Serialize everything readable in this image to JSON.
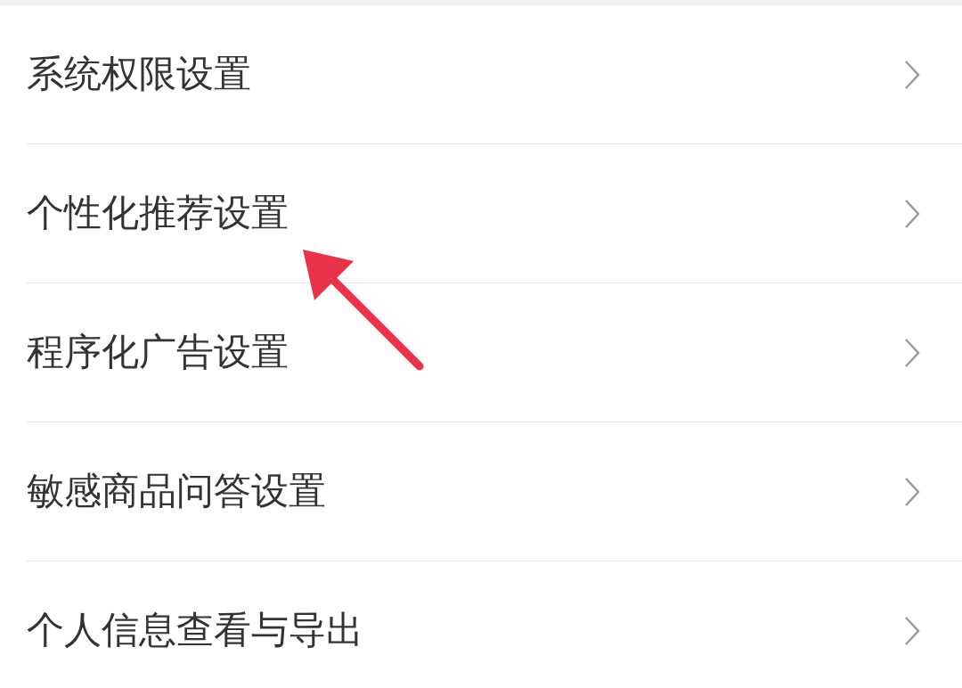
{
  "settings_items": [
    {
      "label": "系统权限设置"
    },
    {
      "label": "个性化推荐设置"
    },
    {
      "label": "程序化广告设置"
    },
    {
      "label": "敏感商品问答设置"
    },
    {
      "label": "个人信息查看与导出"
    }
  ]
}
